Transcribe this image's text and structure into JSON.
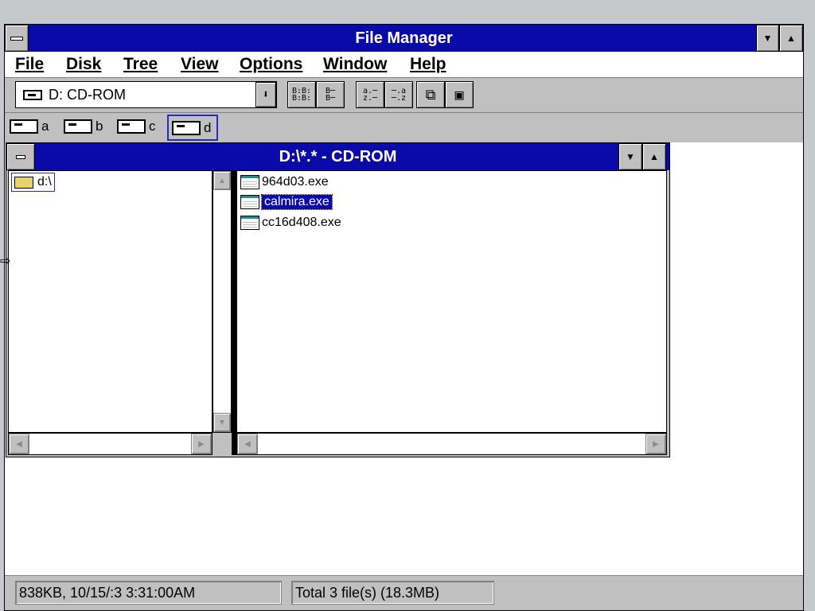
{
  "app": {
    "title": "File Manager"
  },
  "menu": [
    "File",
    "Disk",
    "Tree",
    "View",
    "Options",
    "Window",
    "Help"
  ],
  "drive_select": {
    "value": "D: CD-ROM",
    "icon": "cdrom-drive-icon"
  },
  "toolbar_buttons": [
    {
      "name": "connect-network-drive-button",
      "glyph": "B-B-\nB-B-"
    },
    {
      "name": "disconnect-network-drive-button",
      "glyph": "B-\nB-"
    },
    {
      "name": "view-name-button",
      "glyph": "a-\nz-"
    },
    {
      "name": "view-all-details-button",
      "glyph": "-a\n-z"
    },
    {
      "name": "copy-file-button",
      "glyph": "❐"
    },
    {
      "name": "move-file-button",
      "glyph": "▣"
    }
  ],
  "drives": [
    {
      "letter": "a",
      "icon": "floppy-drive-icon"
    },
    {
      "letter": "b",
      "icon": "floppy-drive-icon"
    },
    {
      "letter": "c",
      "icon": "hard-drive-icon"
    },
    {
      "letter": "d",
      "icon": "cdrom-drive-icon",
      "selected": true
    }
  ],
  "child_window": {
    "title": "D:\\*.* - CD-ROM",
    "tree": [
      {
        "label": "d:\\",
        "icon": "open-folder-icon"
      }
    ],
    "files": [
      {
        "name": "964d03.exe",
        "selected": false,
        "icon": "executable-file-icon"
      },
      {
        "name": "calmira.exe",
        "selected": true,
        "icon": "executable-file-icon"
      },
      {
        "name": "cc16d408.exe",
        "selected": false,
        "icon": "executable-file-icon"
      }
    ]
  },
  "status": {
    "left": "838KB, 10/15/:3 3:31:00AM",
    "right": "Total 3 file(s) (18.3MB)"
  },
  "colors": {
    "title_bar": "#0a0aa8",
    "selection": "#0a0aa8",
    "chrome": "#c0c0c0"
  }
}
